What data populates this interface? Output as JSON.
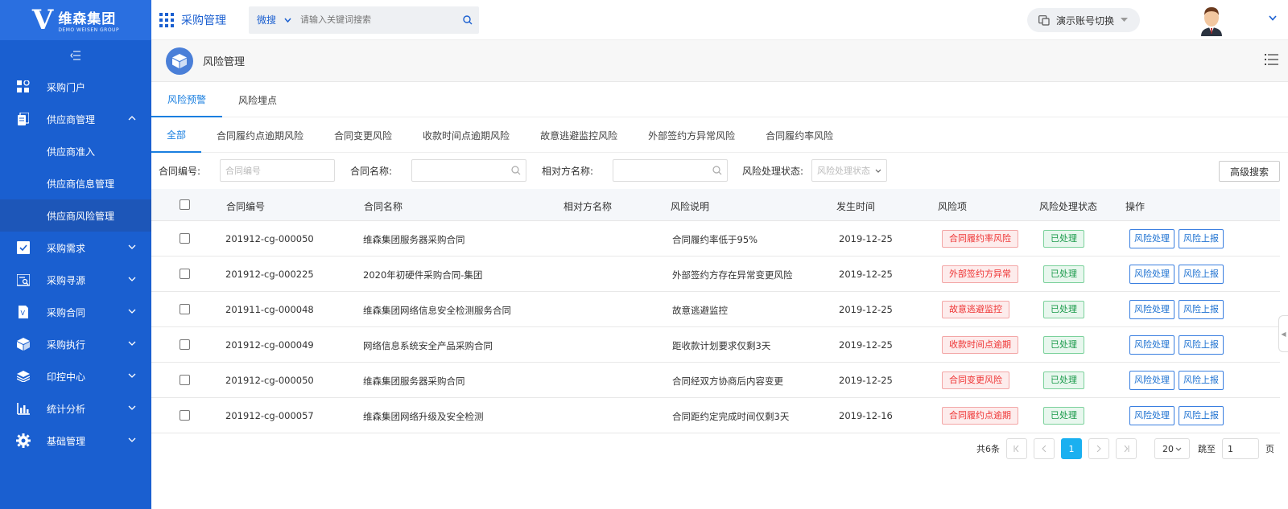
{
  "brand": {
    "name_cn": "维森集团",
    "name_en": "DEMO WEISEN GROUP",
    "mark": "V"
  },
  "topbar": {
    "title": "采购管理",
    "search_type": "微搜",
    "search_placeholder": "请输入关键词搜索",
    "account_switch": "演示账号切换"
  },
  "sidebar": {
    "items": [
      {
        "label": "采购门户",
        "icon": "portal-icon",
        "expandable": false
      },
      {
        "label": "供应商管理",
        "icon": "supplier-icon",
        "expandable": true,
        "expanded": true,
        "children": [
          {
            "label": "供应商准入",
            "active": false
          },
          {
            "label": "供应商信息管理",
            "active": false
          },
          {
            "label": "供应商风险管理",
            "active": true
          }
        ]
      },
      {
        "label": "采购需求",
        "icon": "demand-icon",
        "expandable": true
      },
      {
        "label": "采购寻源",
        "icon": "sourcing-icon",
        "expandable": true
      },
      {
        "label": "采购合同",
        "icon": "contract-icon",
        "expandable": true
      },
      {
        "label": "采购执行",
        "icon": "execution-icon",
        "expandable": true
      },
      {
        "label": "印控中心",
        "icon": "seal-icon",
        "expandable": true
      },
      {
        "label": "统计分析",
        "icon": "stats-icon",
        "expandable": true
      },
      {
        "label": "基础管理",
        "icon": "settings-icon",
        "expandable": true
      }
    ]
  },
  "page": {
    "title": "风险管理"
  },
  "tabs_primary": [
    {
      "label": "风险预警",
      "active": true
    },
    {
      "label": "风险埋点",
      "active": false
    }
  ],
  "tabs_secondary": [
    {
      "label": "全部",
      "active": true
    },
    {
      "label": "合同履约点逾期风险",
      "active": false
    },
    {
      "label": "合同变更风险",
      "active": false
    },
    {
      "label": "收款时间点逾期风险",
      "active": false
    },
    {
      "label": "故意逃避监控风险",
      "active": false
    },
    {
      "label": "外部签约方异常风险",
      "active": false
    },
    {
      "label": "合同履约率风险",
      "active": false
    }
  ],
  "filters": {
    "contract_no_label": "合同编号:",
    "contract_no_placeholder": "合同编号",
    "contract_name_label": "合同名称:",
    "counterparty_label": "相对方名称:",
    "status_label": "风险处理状态:",
    "status_placeholder": "风险处理状态",
    "advanced_search": "高级搜索"
  },
  "table": {
    "headers": [
      "合同编号",
      "合同名称",
      "相对方名称",
      "风险说明",
      "发生时间",
      "风险项",
      "风险处理状态",
      "操作"
    ],
    "rows": [
      {
        "no": "201912-cg-000050",
        "name": "维森集团服务器采购合同",
        "party": "",
        "desc": "合同履约率低于95%",
        "time": "2019-12-25",
        "risk": "合同履约率风险",
        "status": "已处理"
      },
      {
        "no": "201912-cg-000225",
        "name": "2020年初硬件采购合同-集团",
        "party": "",
        "desc": "外部签约方存在异常变更风险",
        "time": "2019-12-25",
        "risk": "外部签约方异常",
        "status": "已处理"
      },
      {
        "no": "201911-cg-000048",
        "name": "维森集团网络信息安全检测服务合同",
        "party": "",
        "desc": "故意逃避监控",
        "time": "2019-12-25",
        "risk": "故意逃避监控",
        "status": "已处理"
      },
      {
        "no": "201912-cg-000049",
        "name": "网络信息系统安全产品采购合同",
        "party": "",
        "desc": "距收款计划要求仅剩3天",
        "time": "2019-12-25",
        "risk": "收款时间点逾期",
        "status": "已处理"
      },
      {
        "no": "201912-cg-000050",
        "name": "维森集团服务器采购合同",
        "party": "",
        "desc": "合同经双方协商后内容变更",
        "time": "2019-12-25",
        "risk": "合同变更风险",
        "status": "已处理"
      },
      {
        "no": "201912-cg-000057",
        "name": "维森集团网络升级及安全检测",
        "party": "",
        "desc": "合同距约定完成时间仅剩3天",
        "time": "2019-12-16",
        "risk": "合同履约点逾期",
        "status": "已处理"
      }
    ],
    "actions": {
      "handle": "风险处理",
      "report": "风险上报"
    }
  },
  "pagination": {
    "total": "共6条",
    "current_page": "1",
    "page_size": "20",
    "jump_label": "跳至",
    "jump_value": "1",
    "unit": "页"
  },
  "colors": {
    "sidebar": "#1a5fd0",
    "accent": "#1a7fe0",
    "danger": "#e33333",
    "success": "#1a9a4a"
  }
}
